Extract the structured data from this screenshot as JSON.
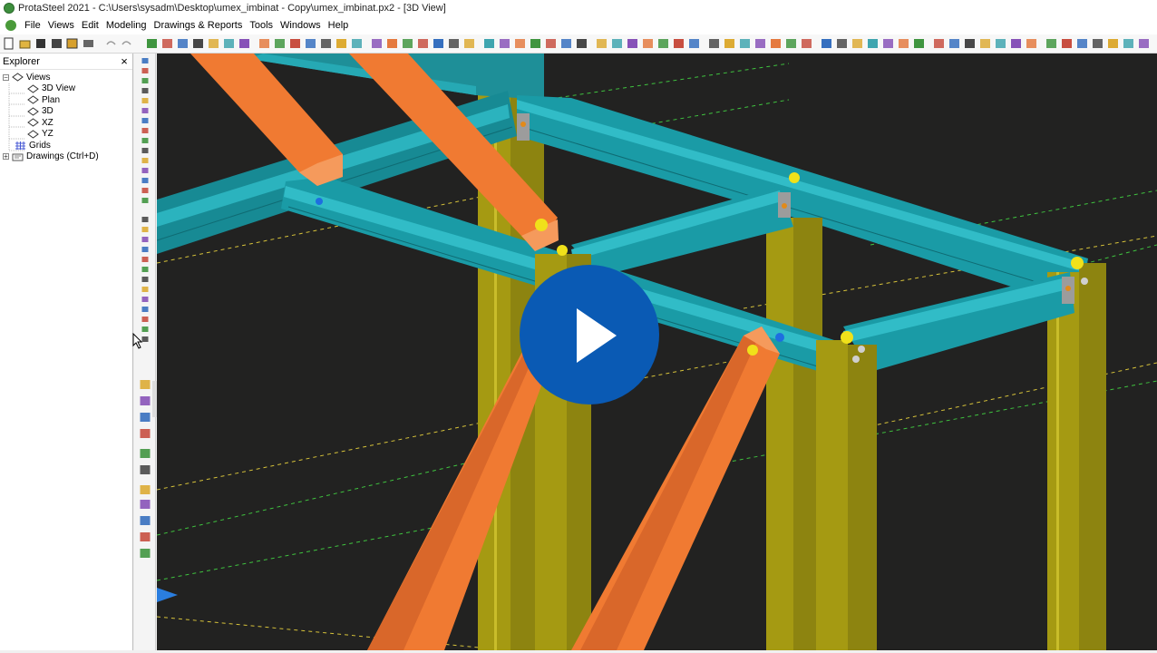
{
  "window": {
    "title": "ProtaSteel 2021 - C:\\Users\\sysadm\\Desktop\\umex_imbinat - Copy\\umex_imbinat.px2 - [3D View]"
  },
  "menu": {
    "items": [
      "File",
      "Views",
      "Edit",
      "Modeling",
      "Drawings & Reports",
      "Tools",
      "Windows",
      "Help"
    ]
  },
  "explorer": {
    "title": "Explorer",
    "close_label": "×",
    "tree": {
      "views": "Views",
      "view_3d": "3D View",
      "plan": "Plan",
      "d3": "3D",
      "xz": "XZ",
      "yz": "YZ",
      "grids": "Grids",
      "drawings": "Drawings (Ctrl+D)"
    }
  },
  "colors": {
    "viewport_bg": "#222221",
    "beam_cyan": "#1a9ba6",
    "column_olive": "#a59a12",
    "brace_orange": "#f07a32",
    "grid_green": "#3fc23f",
    "grid_yellow": "#d6c23a",
    "play_blue": "#0a5ab4"
  },
  "icons": {
    "play": "play-icon",
    "close": "close-icon",
    "app": "protasteel-logo-icon"
  }
}
